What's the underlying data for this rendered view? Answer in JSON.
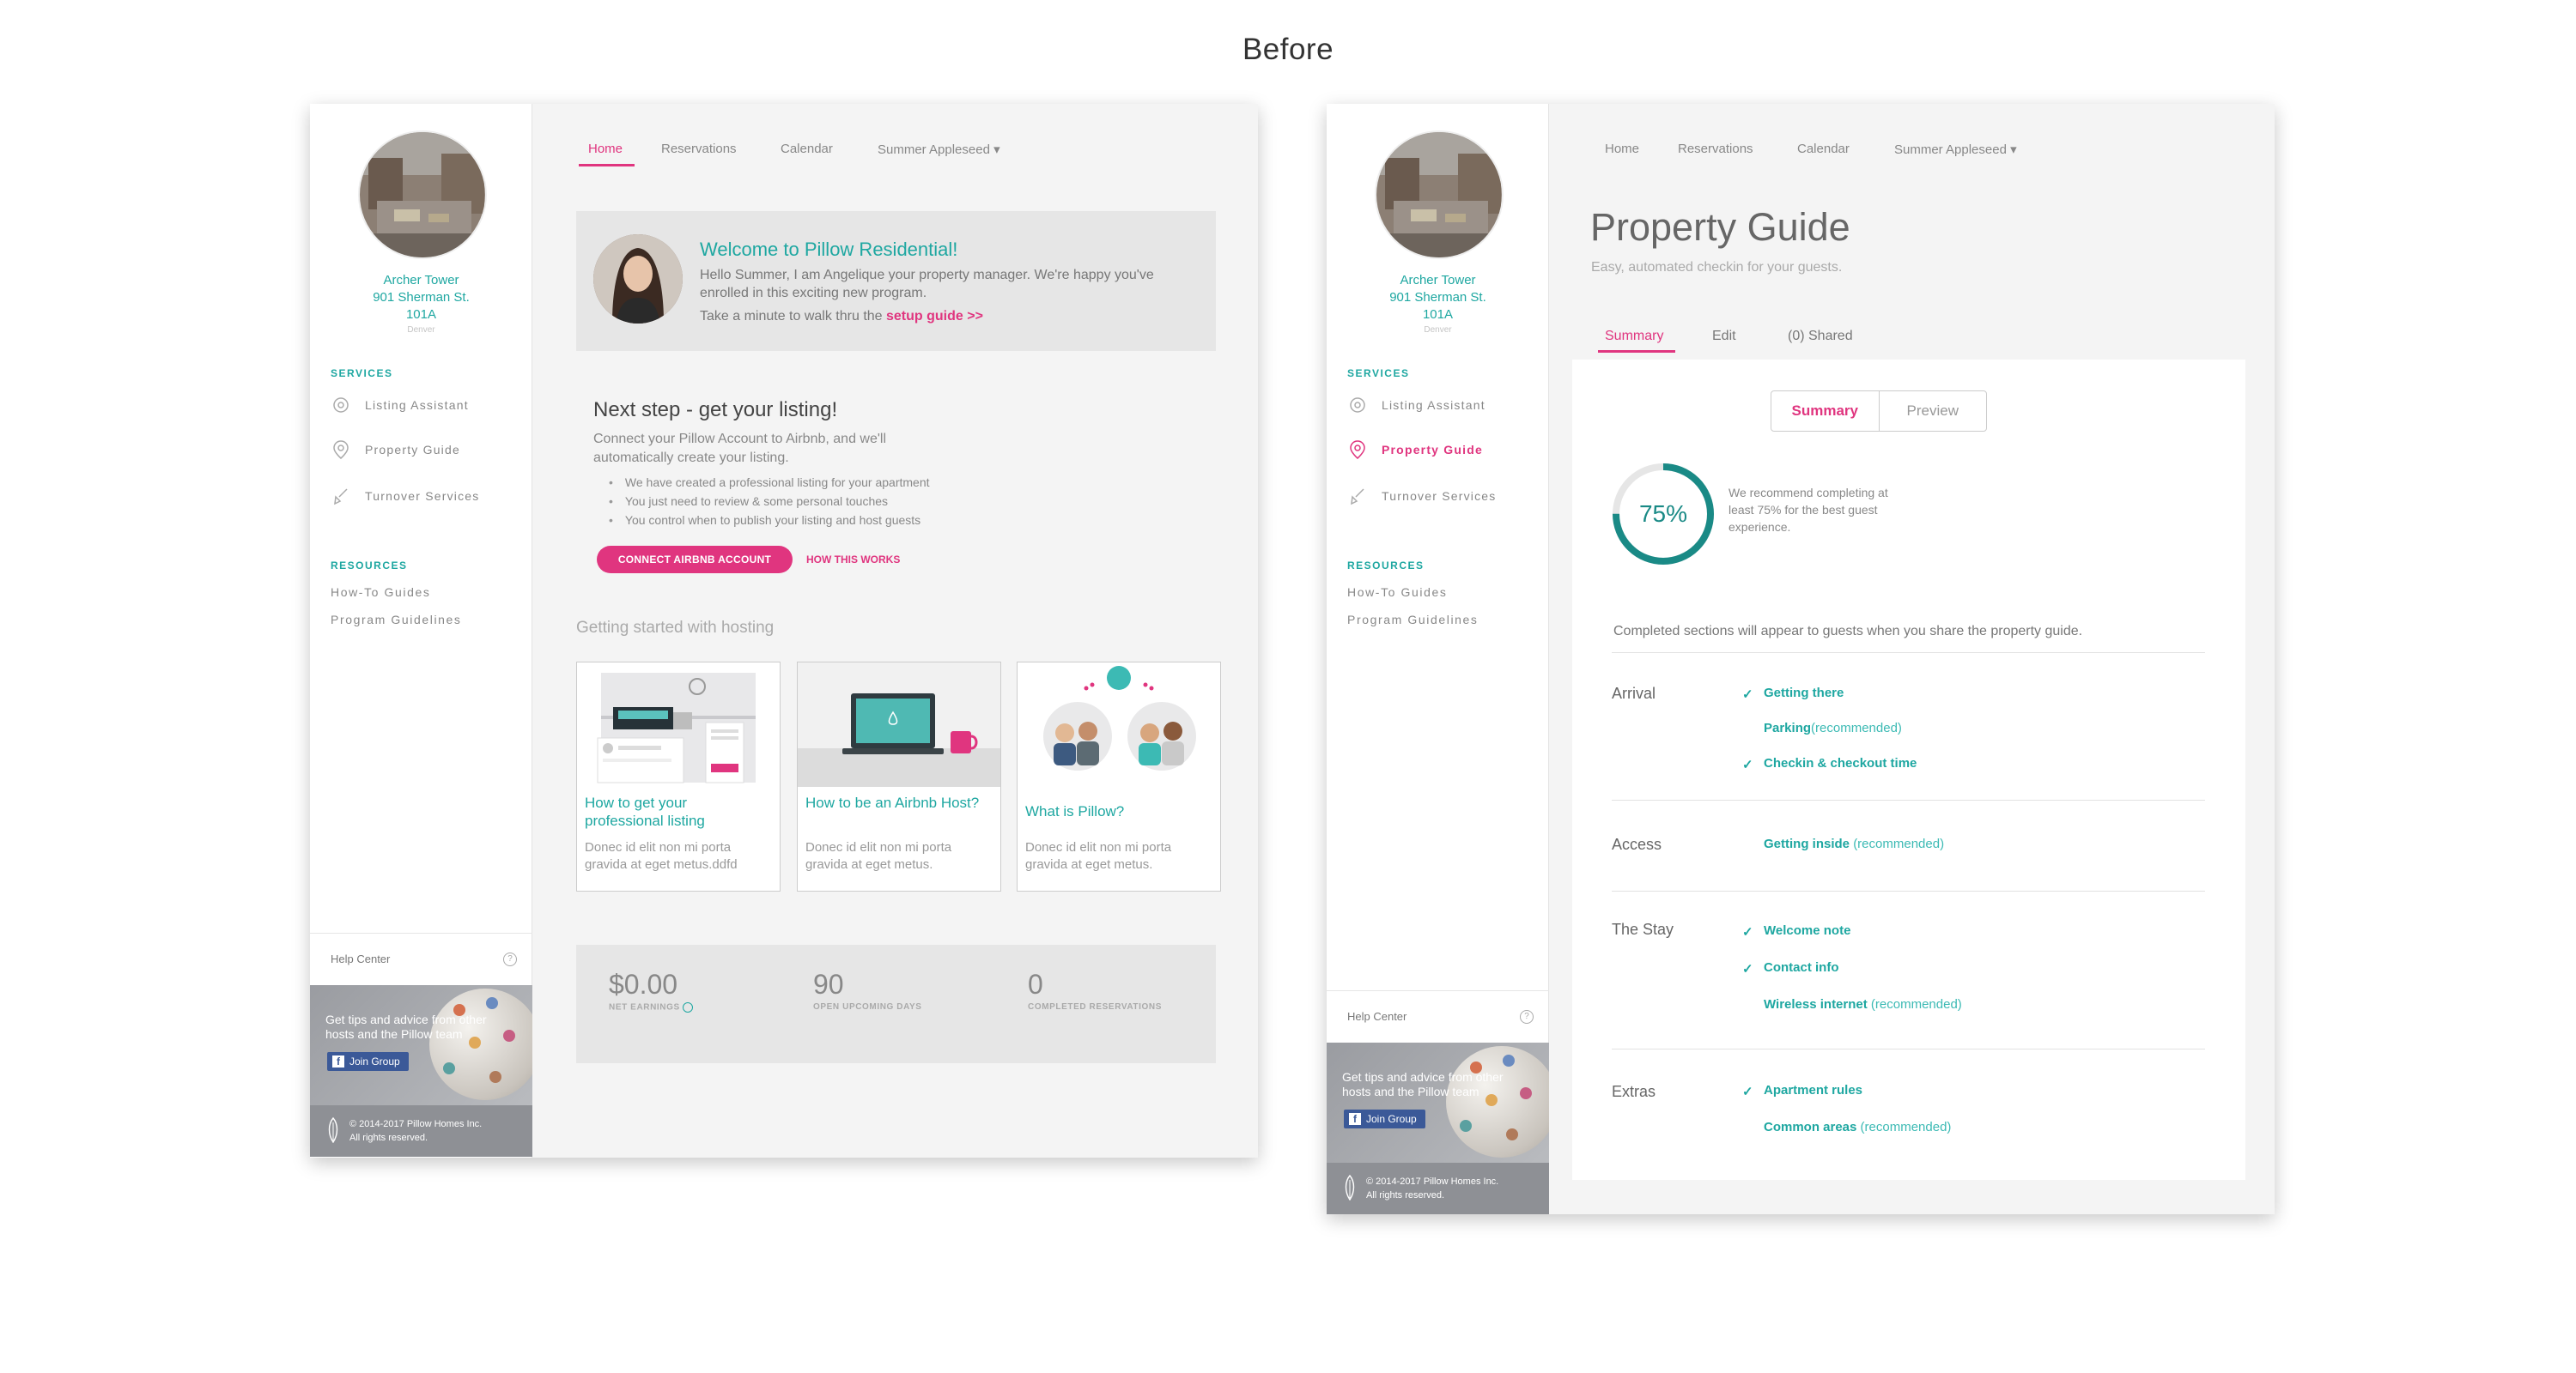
{
  "page_title": "Before",
  "sidebar": {
    "address": [
      "Archer Tower",
      "901 Sherman St.",
      "101A"
    ],
    "city": "Denver",
    "services_heading": "SERVICES",
    "services": [
      "Listing Assistant",
      "Property Guide",
      "Turnover Services"
    ],
    "resources_heading": "RESOURCES",
    "resources": [
      "How-To Guides",
      "Program Guidelines"
    ],
    "help_center": "Help Center",
    "help_q": "?",
    "promo_text": "Get tips and advice from other hosts and the Pillow team",
    "join_label": "Join Group",
    "join_icon": "f",
    "copyright": [
      "© 2014-2017 Pillow Homes Inc.",
      "All rights reserved."
    ]
  },
  "nav": {
    "items": [
      "Home",
      "Reservations",
      "Calendar",
      "Summer Appleseed ▾"
    ]
  },
  "home": {
    "welcome_title": "Welcome to Pillow Residential!",
    "welcome_body": "Hello Summer, I am Angelique your property manager. We're happy you've enrolled in this exciting new program.",
    "welcome_link_prefix": "Take a minute to walk thru the ",
    "welcome_link": "setup guide >>",
    "next_title": "Next step - get your listing!",
    "next_body": "Connect your Pillow Account to Airbnb, and we'll automatically create your listing.",
    "bullets": [
      "We have created a professional listing for your apartment",
      "You just need to review & some personal touches",
      "You control when to publish your listing and host guests"
    ],
    "connect_button": "CONNECT AIRBNB ACCOUNT",
    "how_link": "HOW THIS WORKS",
    "getting_started": "Getting started with hosting",
    "cards": [
      {
        "title": "How to get your professional listing",
        "body": "Donec id elit non mi porta gravida at eget metus.ddfd"
      },
      {
        "title": "How to be an Airbnb Host?",
        "body": "Donec id elit non mi porta gravida at eget metus."
      },
      {
        "title": "What is Pillow?",
        "body": "Donec id elit non mi porta gravida at eget metus."
      }
    ],
    "stats": [
      {
        "value": "$0.00",
        "label": "NET EARNINGS"
      },
      {
        "value": "90",
        "label": "OPEN UPCOMING DAYS"
      },
      {
        "value": "0",
        "label": "COMPLETED RESERVATIONS"
      }
    ]
  },
  "guide": {
    "title": "Property Guide",
    "subtitle": "Easy, automated checkin for your guests.",
    "tabs": [
      "Summary",
      "Edit",
      "(0) Shared"
    ],
    "segments": [
      "Summary",
      "Preview"
    ],
    "progress_label": "75%",
    "progress_value": 0.75,
    "recommend": "We recommend completing at least 75% for the best guest experience.",
    "completed_note": "Completed sections will appear to guests when you share the property guide.",
    "recommended_tag": "(recommended)",
    "groups": [
      {
        "name": "Arrival",
        "items": [
          {
            "label": "Getting there",
            "done": true,
            "rec": false
          },
          {
            "label": "Parking",
            "done": false,
            "rec": true
          },
          {
            "label": "Checkin & checkout time",
            "done": true,
            "rec": false
          }
        ]
      },
      {
        "name": "Access",
        "items": [
          {
            "label": "Getting inside",
            "done": false,
            "rec": true
          }
        ]
      },
      {
        "name": "The Stay",
        "items": [
          {
            "label": "Welcome note",
            "done": true,
            "rec": false
          },
          {
            "label": "Contact info",
            "done": true,
            "rec": false
          },
          {
            "label": "Wireless internet",
            "done": false,
            "rec": true
          }
        ]
      },
      {
        "name": "Extras",
        "items": [
          {
            "label": "Apartment rules",
            "done": true,
            "rec": false
          },
          {
            "label": "Common areas",
            "done": false,
            "rec": true
          }
        ]
      }
    ]
  },
  "colors": {
    "accent": "#e0357f",
    "teal": "#1ea7a1"
  }
}
